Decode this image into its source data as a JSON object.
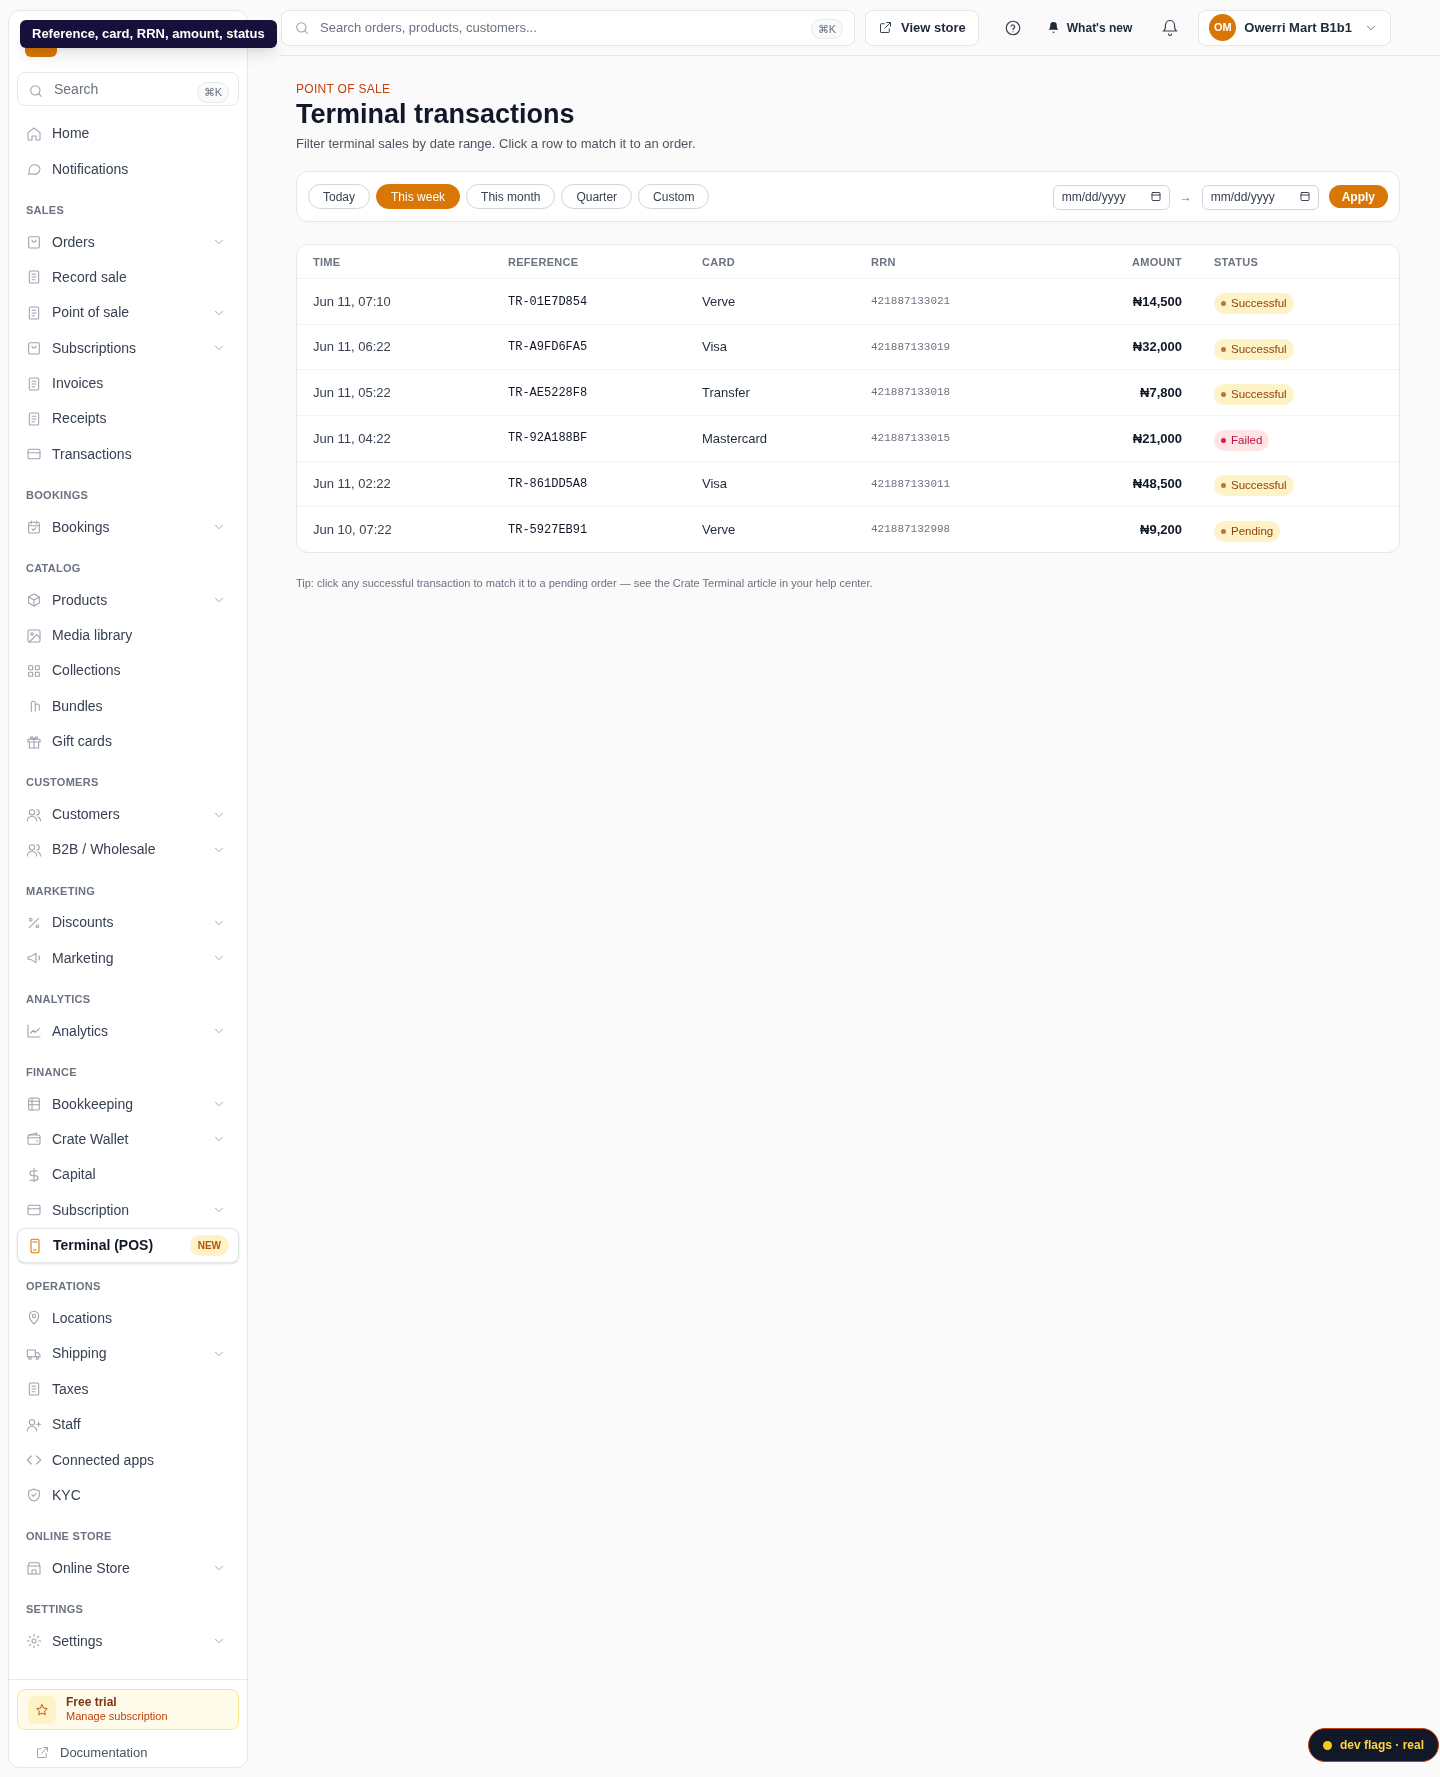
{
  "tooltip": "Reference, card, RRN, amount, status",
  "sidebar": {
    "search": {
      "placeholder": "Search",
      "shortcut": "⌘K"
    },
    "sections": [
      {
        "items": [
          {
            "label": "Home",
            "expandable": false,
            "selected": false
          },
          {
            "label": "Notifications",
            "expandable": false,
            "selected": false
          }
        ]
      },
      {
        "title": "SALES",
        "items": [
          {
            "label": "Orders",
            "expandable": true,
            "selected": false
          },
          {
            "label": "Record sale",
            "expandable": false,
            "selected": false
          },
          {
            "label": "Point of sale",
            "expandable": true,
            "selected": false
          },
          {
            "label": "Subscriptions",
            "expandable": true,
            "selected": false
          },
          {
            "label": "Invoices",
            "expandable": false,
            "selected": false
          },
          {
            "label": "Receipts",
            "expandable": false,
            "selected": false
          },
          {
            "label": "Transactions",
            "expandable": false,
            "selected": false
          }
        ]
      },
      {
        "title": "BOOKINGS",
        "items": [
          {
            "label": "Bookings",
            "expandable": true,
            "selected": false
          }
        ]
      },
      {
        "title": "CATALOG",
        "items": [
          {
            "label": "Products",
            "expandable": true,
            "selected": false
          },
          {
            "label": "Media library",
            "expandable": false,
            "selected": false
          },
          {
            "label": "Collections",
            "expandable": false,
            "selected": false
          },
          {
            "label": "Bundles",
            "expandable": false,
            "selected": false
          },
          {
            "label": "Gift cards",
            "expandable": false,
            "selected": false
          }
        ]
      },
      {
        "title": "CUSTOMERS",
        "items": [
          {
            "label": "Customers",
            "expandable": true,
            "selected": false
          },
          {
            "label": "B2B / Wholesale",
            "expandable": true,
            "selected": false
          }
        ]
      },
      {
        "title": "MARKETING",
        "items": [
          {
            "label": "Discounts",
            "expandable": true,
            "selected": false
          },
          {
            "label": "Marketing",
            "expandable": true,
            "selected": false
          }
        ]
      },
      {
        "title": "ANALYTICS",
        "items": [
          {
            "label": "Analytics",
            "expandable": true,
            "selected": false
          }
        ]
      },
      {
        "title": "FINANCE",
        "items": [
          {
            "label": "Bookkeeping",
            "expandable": true,
            "selected": false
          },
          {
            "label": "Crate Wallet",
            "expandable": true,
            "selected": false
          },
          {
            "label": "Capital",
            "expandable": false,
            "selected": false
          },
          {
            "label": "Subscription",
            "expandable": true,
            "selected": false
          },
          {
            "label": "Terminal (POS)",
            "expandable": false,
            "selected": true,
            "badge": "NEW"
          }
        ]
      },
      {
        "title": "OPERATIONS",
        "items": [
          {
            "label": "Locations",
            "expandable": false,
            "selected": false
          },
          {
            "label": "Shipping",
            "expandable": true,
            "selected": false
          },
          {
            "label": "Taxes",
            "expandable": false,
            "selected": false
          },
          {
            "label": "Staff",
            "expandable": false,
            "selected": false
          },
          {
            "label": "Connected apps",
            "expandable": false,
            "selected": false
          },
          {
            "label": "KYC",
            "expandable": false,
            "selected": false
          }
        ]
      },
      {
        "title": "ONLINE STORE",
        "items": [
          {
            "label": "Online Store",
            "expandable": true,
            "selected": false
          }
        ]
      },
      {
        "title": "SETTINGS",
        "items": [
          {
            "label": "Settings",
            "expandable": true,
            "selected": false
          }
        ]
      }
    ],
    "trial": {
      "title": "Free trial",
      "link": "Manage subscription"
    },
    "documentation": "Documentation"
  },
  "topbar": {
    "search": {
      "placeholder": "Search orders, products, customers...",
      "shortcut": "⌘K"
    },
    "view_store": "View store",
    "whats_new": "What's new",
    "account": {
      "initials": "OM",
      "name": "Owerri Mart B1b1"
    }
  },
  "page": {
    "eyebrow": "POINT OF SALE",
    "title": "Terminal transactions",
    "subtitle": "Filter terminal sales by date range. Click a row to match it to an order."
  },
  "filters": {
    "ranges": [
      {
        "label": "Today",
        "selected": false
      },
      {
        "label": "This week",
        "selected": true
      },
      {
        "label": "This month",
        "selected": false
      },
      {
        "label": "Quarter",
        "selected": false
      },
      {
        "label": "Custom",
        "selected": false
      }
    ],
    "from": {
      "placeholder": "mm/dd/yyyy"
    },
    "arrow": "→",
    "to": {
      "placeholder": "mm/dd/yyyy"
    },
    "apply": "Apply"
  },
  "table": {
    "columns": [
      "TIME",
      "REFERENCE",
      "CARD",
      "RRN",
      "AMOUNT",
      "STATUS"
    ],
    "rows": [
      {
        "time": "Jun 11, 07:10",
        "reference": "TR-01E7D854",
        "card": "Verve",
        "rrn": "421887133021",
        "amount": "₦14,500",
        "status": {
          "label": "Successful",
          "kind": "success",
          "color": "#b7773e"
        }
      },
      {
        "time": "Jun 11, 06:22",
        "reference": "TR-A9FD6FA5",
        "card": "Visa",
        "rrn": "421887133019",
        "amount": "₦32,000",
        "status": {
          "label": "Successful",
          "kind": "success",
          "color": "#b7773e"
        }
      },
      {
        "time": "Jun 11, 05:22",
        "reference": "TR-AE5228F8",
        "card": "Transfer",
        "rrn": "421887133018",
        "amount": "₦7,800",
        "status": {
          "label": "Successful",
          "kind": "success",
          "color": "#b7773e"
        }
      },
      {
        "time": "Jun 11, 04:22",
        "reference": "TR-92A188BF",
        "card": "Mastercard",
        "rrn": "421887133015",
        "amount": "₦21,000",
        "status": {
          "label": "Failed",
          "kind": "failed",
          "color": "#e11d48"
        }
      },
      {
        "time": "Jun 11, 02:22",
        "reference": "TR-861DD5A8",
        "card": "Visa",
        "rrn": "421887133011",
        "amount": "₦48,500",
        "status": {
          "label": "Successful",
          "kind": "success",
          "color": "#b7773e"
        }
      },
      {
        "time": "Jun 10, 07:22",
        "reference": "TR-5927EB91",
        "card": "Verve",
        "rrn": "421887132998",
        "amount": "₦9,200",
        "status": {
          "label": "Pending",
          "kind": "pending",
          "color": "#b7773e"
        }
      }
    ]
  },
  "tip": "Tip: click any successful transaction to match it to a pending order — see the Crate Terminal article in your help center.",
  "dev_flags": "dev flags · real"
}
